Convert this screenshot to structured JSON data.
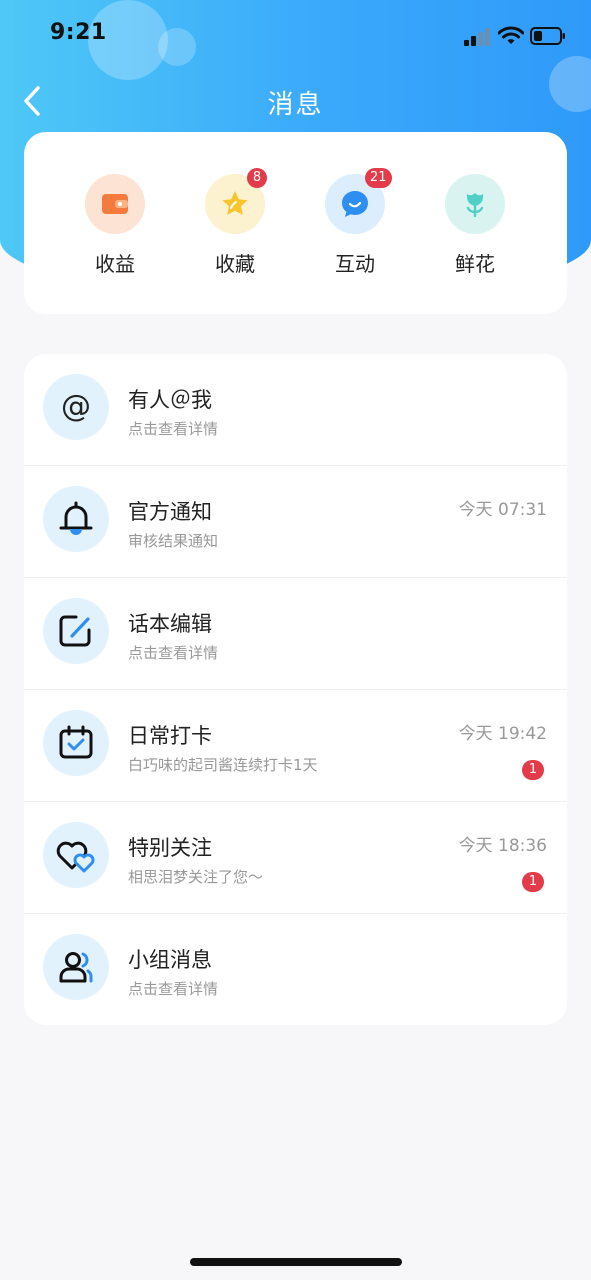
{
  "status_bar": {
    "time": "9:21"
  },
  "nav": {
    "title": "消息"
  },
  "quick_actions": [
    {
      "label": "收益",
      "icon": "wallet-icon",
      "badge": ""
    },
    {
      "label": "收藏",
      "icon": "star-icon",
      "badge": "8"
    },
    {
      "label": "互动",
      "icon": "chat-bubble-icon",
      "badge": "21"
    },
    {
      "label": "鲜花",
      "icon": "flower-icon",
      "badge": ""
    }
  ],
  "messages": [
    {
      "title": "有人＠我",
      "subtitle": "点击查看详情",
      "time": "",
      "badge": "",
      "icon": "at-icon"
    },
    {
      "title": "官方通知",
      "subtitle": "审核结果通知",
      "time": "今天 07:31",
      "badge": "",
      "icon": "bell-icon"
    },
    {
      "title": "话本编辑",
      "subtitle": "点击查看详情",
      "time": "",
      "badge": "",
      "icon": "edit-icon"
    },
    {
      "title": "日常打卡",
      "subtitle": "白巧味的起司酱连续打卡1天",
      "time": "今天 19:42",
      "badge": "1",
      "icon": "calendar-check-icon"
    },
    {
      "title": "特别关注",
      "subtitle": "相思泪梦关注了您～",
      "time": "今天 18:36",
      "badge": "1",
      "icon": "hearts-icon"
    },
    {
      "title": "小组消息",
      "subtitle": "点击查看详情",
      "time": "",
      "badge": "",
      "icon": "group-icon"
    }
  ],
  "colors": {
    "accent": "#3aa9fb",
    "badge": "#e23c4a"
  }
}
